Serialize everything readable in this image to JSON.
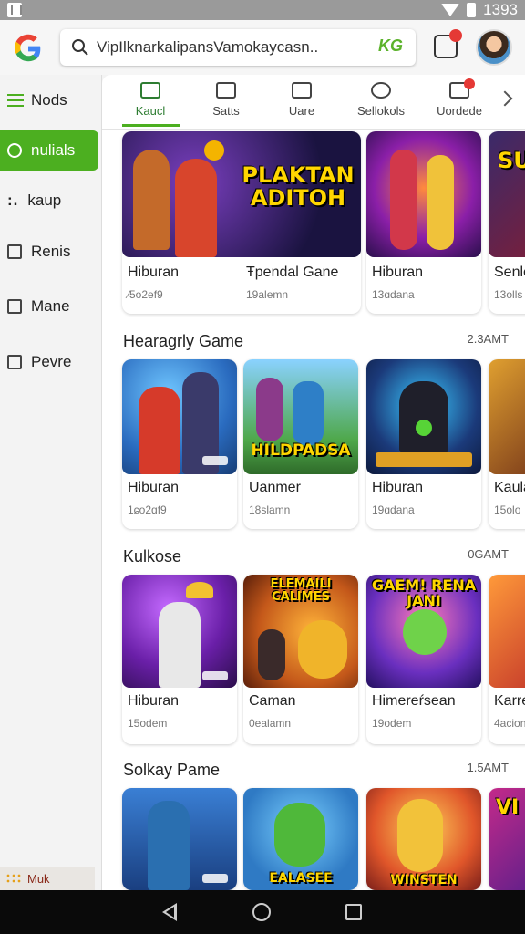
{
  "status_bar": {
    "time": "1393"
  },
  "search": {
    "text": "VipIlknarkalipansVamokaycasn..",
    "badge": "KG"
  },
  "sidebar": {
    "items": [
      {
        "label": "Nods",
        "icon": "menu-icon"
      },
      {
        "label": "nulials",
        "icon": "search-icon",
        "active": true
      },
      {
        "label": "kaup",
        "icon": "dots-icon"
      },
      {
        "label": "Renis",
        "icon": "clipboard-icon"
      },
      {
        "label": "Mane",
        "icon": "close-box-icon"
      },
      {
        "label": "Pevre",
        "icon": "window-icon"
      }
    ],
    "footer": "Muk"
  },
  "tabs": [
    {
      "label": "Kaucl",
      "icon": "edit-icon",
      "active": true
    },
    {
      "label": "Satts",
      "icon": "news-icon"
    },
    {
      "label": "Uare",
      "icon": "close-box-icon"
    },
    {
      "label": "Sellokols",
      "icon": "smiley-icon"
    },
    {
      "label": "Uordede",
      "icon": "share-icon"
    }
  ],
  "featured": {
    "cards": [
      {
        "title": "Hiburan",
        "sub": "⁄5o2ef9",
        "art_text": "PLAKTAN ADITOH"
      },
      {
        "title": "Ŧpendal Gane",
        "sub": "19alemn",
        "art_text": ""
      },
      {
        "title": "Hiburan",
        "sub": "13ɑdana",
        "art_text": ""
      },
      {
        "title": "Senle",
        "sub": "13olls",
        "art_text": "SU"
      }
    ]
  },
  "sections": [
    {
      "title": "Hearagrly Game",
      "meta": "2.3AMT",
      "cards": [
        {
          "title": "Hiburan",
          "sub": "1ɕo2ɑf9",
          "art_text": ""
        },
        {
          "title": "Uanmer",
          "sub": "18slamn",
          "art_text": "HILDPADSA"
        },
        {
          "title": "Hiburan",
          "sub": "19ɑdana",
          "art_text": ""
        },
        {
          "title": "Kaula",
          "sub": "15olo",
          "art_text": ""
        }
      ]
    },
    {
      "title": "Kulkose",
      "meta": "0GAMT",
      "cards": [
        {
          "title": "Hiburan",
          "sub": "15odem",
          "art_text": ""
        },
        {
          "title": "Caman",
          "sub": "0ealamn",
          "art_text": "ELEMAILI CALIMES"
        },
        {
          "title": "Himereŕsean",
          "sub": "19odem",
          "art_text": "GAEM! RENA JANI"
        },
        {
          "title": "Karre",
          "sub": "4acion",
          "art_text": ""
        }
      ]
    },
    {
      "title": "Solkay Pame",
      "meta": "1.5AMT",
      "cards": [
        {
          "title": "",
          "sub": "",
          "art_text": ""
        },
        {
          "title": "",
          "sub": "",
          "art_text": "EALASEE"
        },
        {
          "title": "",
          "sub": "",
          "art_text": "WINSTEN"
        },
        {
          "title": "",
          "sub": "",
          "art_text": "VI"
        }
      ]
    }
  ],
  "colors": {
    "accent": "#4caf20",
    "badge": "#e53935"
  }
}
